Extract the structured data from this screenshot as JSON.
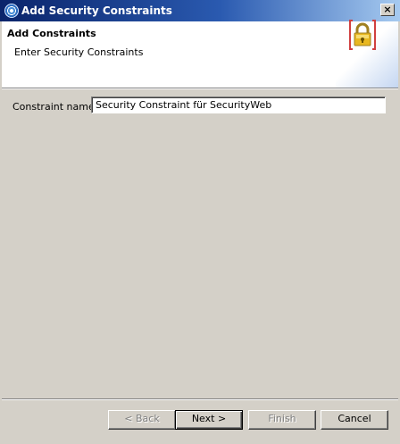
{
  "window": {
    "title": "Add Security Constraints",
    "close_glyph": "×",
    "app_icon": "wsad-app-icon"
  },
  "header": {
    "title": "Add Constraints",
    "description": "Enter Security Constraints",
    "graphic_icon": "lock-icon"
  },
  "form": {
    "constraint_name_label": "Constraint name:",
    "constraint_name_value": "Security Constraint für SecurityWeb"
  },
  "buttons": {
    "back": "< Back",
    "next": "Next >",
    "finish": "Finish",
    "cancel": "Cancel"
  },
  "colors": {
    "dialog_bg": "#d4d0c8",
    "titlebar_start": "#0a246a",
    "titlebar_end": "#a6caf0",
    "lock_gold": "#e8b820",
    "lock_bracket": "#d04040"
  }
}
